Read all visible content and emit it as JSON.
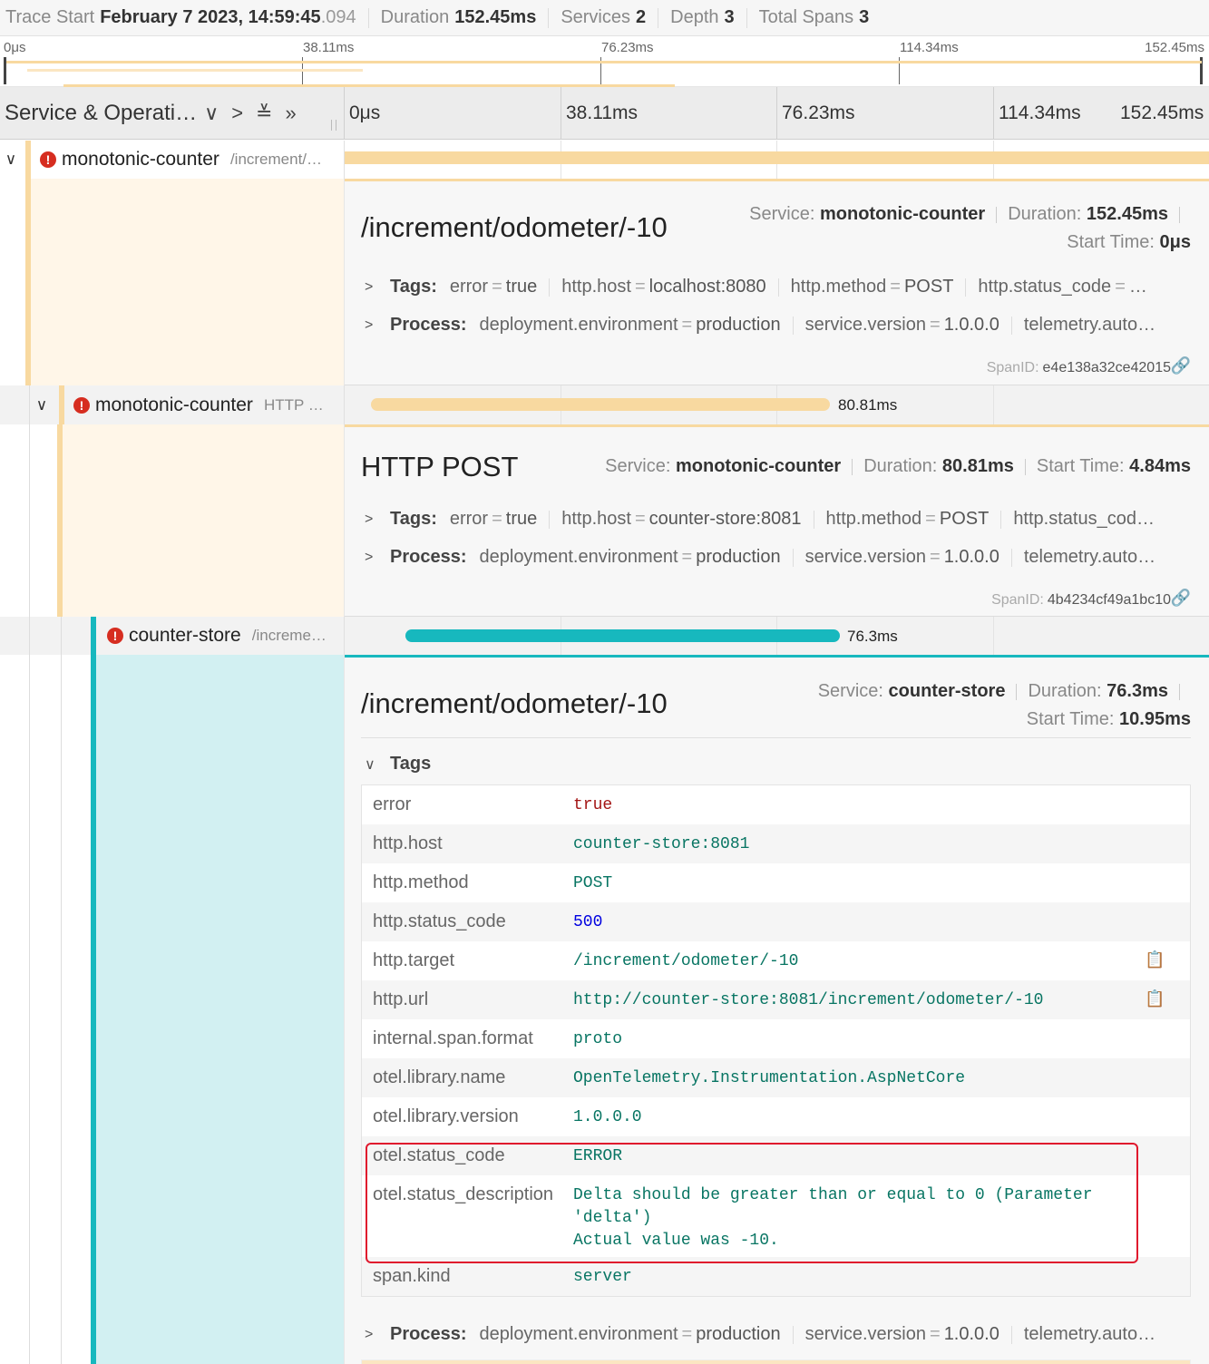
{
  "trace_header": {
    "start_label": "Trace Start",
    "start_value": "February 7 2023, 14:59:45",
    "start_ms": ".094",
    "duration_label": "Duration",
    "duration_value": "152.45ms",
    "services_label": "Services",
    "services_value": "2",
    "depth_label": "Depth",
    "depth_value": "3",
    "spans_label": "Total Spans",
    "spans_value": "3"
  },
  "minimap": {
    "ticks": [
      "0μs",
      "38.11ms",
      "76.23ms",
      "114.34ms",
      "152.45ms"
    ]
  },
  "timeline_header": {
    "title": "Service & Operati…",
    "ticks": [
      "0μs",
      "38.11ms",
      "76.23ms",
      "114.34ms",
      "152.45ms"
    ]
  },
  "spans": [
    {
      "service": "monotonic-counter",
      "operation": "/increment/…",
      "bar_label": "",
      "detail": {
        "title": "/increment/odometer/-10",
        "service_label": "Service:",
        "service": "monotonic-counter",
        "duration_label": "Duration:",
        "duration": "152.45ms",
        "start_label": "Start Time:",
        "start": "0μs",
        "tags_label": "Tags:",
        "tags": [
          {
            "k": "error",
            "v": "true"
          },
          {
            "k": "http.host",
            "v": "localhost:8080"
          },
          {
            "k": "http.method",
            "v": "POST"
          },
          {
            "k": "http.status_code",
            "v": "…"
          }
        ],
        "process_label": "Process:",
        "process": [
          {
            "k": "deployment.environment",
            "v": "production"
          },
          {
            "k": "service.version",
            "v": "1.0.0.0"
          },
          {
            "k": "telemetry.auto…",
            "v": ""
          }
        ],
        "span_id_label": "SpanID:",
        "span_id": "e4e138a32ce42015"
      }
    },
    {
      "service": "monotonic-counter",
      "operation": "HTTP …",
      "bar_label": "80.81ms",
      "detail": {
        "title": "HTTP POST",
        "service_label": "Service:",
        "service": "monotonic-counter",
        "duration_label": "Duration:",
        "duration": "80.81ms",
        "start_label": "Start Time:",
        "start": "4.84ms",
        "tags_label": "Tags:",
        "tags": [
          {
            "k": "error",
            "v": "true"
          },
          {
            "k": "http.host",
            "v": "counter-store:8081"
          },
          {
            "k": "http.method",
            "v": "POST"
          },
          {
            "k": "http.status_cod…",
            "v": ""
          }
        ],
        "process_label": "Process:",
        "process": [
          {
            "k": "deployment.environment",
            "v": "production"
          },
          {
            "k": "service.version",
            "v": "1.0.0.0"
          },
          {
            "k": "telemetry.auto…",
            "v": ""
          }
        ],
        "span_id_label": "SpanID:",
        "span_id": "4b4234cf49a1bc10"
      }
    },
    {
      "service": "counter-store",
      "operation": "/increme…",
      "bar_label": "76.3ms",
      "detail": {
        "title": "/increment/odometer/-10",
        "service_label": "Service:",
        "service": "counter-store",
        "duration_label": "Duration:",
        "duration": "76.3ms",
        "start_label": "Start Time:",
        "start": "10.95ms",
        "tags_label": "Tags",
        "tags_table": [
          {
            "k": "error",
            "v": "true"
          },
          {
            "k": "http.host",
            "v": "counter-store:8081"
          },
          {
            "k": "http.method",
            "v": "POST"
          },
          {
            "k": "http.status_code",
            "v": "500"
          },
          {
            "k": "http.target",
            "v": "/increment/odometer/-10"
          },
          {
            "k": "http.url",
            "v": "http://counter-store:8081/increment/odometer/-10"
          },
          {
            "k": "internal.span.format",
            "v": "proto"
          },
          {
            "k": "otel.library.name",
            "v": "OpenTelemetry.Instrumentation.AspNetCore"
          },
          {
            "k": "otel.library.version",
            "v": "1.0.0.0"
          },
          {
            "k": "otel.status_code",
            "v": "ERROR"
          },
          {
            "k": "otel.status_description",
            "v": "Delta should be greater than or equal to 0 (Parameter\n'delta')\nActual value was -10."
          },
          {
            "k": "span.kind",
            "v": "server"
          }
        ],
        "process_label": "Process:",
        "process": [
          {
            "k": "deployment.environment",
            "v": "production"
          },
          {
            "k": "service.version",
            "v": "1.0.0.0"
          },
          {
            "k": "telemetry.auto…",
            "v": ""
          }
        ]
      }
    }
  ],
  "colors": {
    "span_yellow": "#f8d9a0",
    "span_yellow_bg": "#fff6e8",
    "span_teal": "#17b8be",
    "span_teal_bg": "#d2f0f2",
    "error_red": "#d62d20",
    "highlight_red": "#e0182d"
  }
}
